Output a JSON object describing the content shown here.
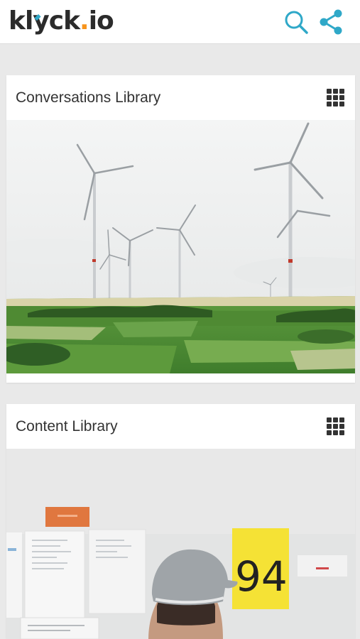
{
  "header": {
    "logo_text_a": "kl",
    "logo_text_b": "y",
    "logo_text_c": "ck",
    "logo_dot": ".",
    "logo_text_d": "io",
    "search_icon": "search-icon",
    "share_icon": "share-icon"
  },
  "colors": {
    "accent": "#2fa8c8",
    "logo_dot": "#f7941d",
    "background": "#e9e9e9"
  },
  "cards": [
    {
      "title": "Conversations Library",
      "menu_icon": "grid-menu-icon",
      "image": "wind-turbines-field-image"
    },
    {
      "title": "Content Library",
      "menu_icon": "grid-menu-icon",
      "image": "man-in-cap-office-wall-image"
    }
  ]
}
